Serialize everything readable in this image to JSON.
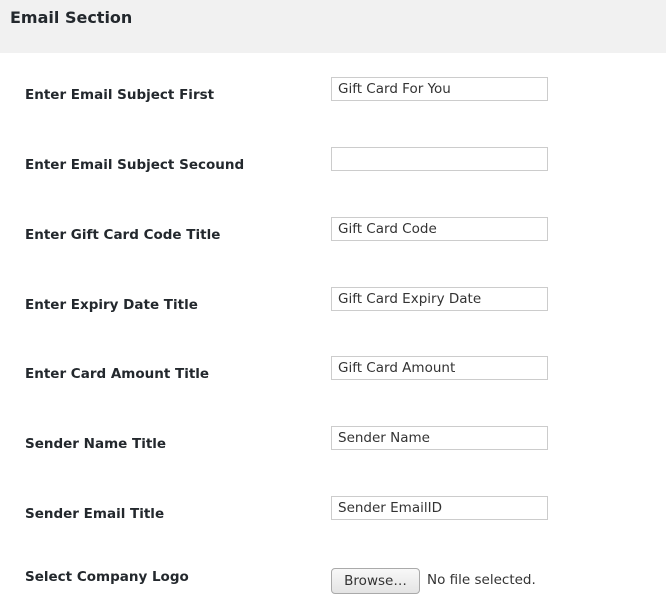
{
  "section": {
    "title": "Email Section"
  },
  "fields": [
    {
      "label": "Enter Email Subject First",
      "value": "Gift Card For You"
    },
    {
      "label": "Enter Email Subject Secound",
      "value": ""
    },
    {
      "label": "Enter Gift Card Code Title",
      "value": "Gift Card Code"
    },
    {
      "label": "Enter Expiry Date Title",
      "value": "Gift Card Expiry Date"
    },
    {
      "label": "Enter Card Amount Title",
      "value": "Gift Card Amount"
    },
    {
      "label": "Sender Name Title",
      "value": "Sender Name"
    },
    {
      "label": "Sender Email Title",
      "value": "Sender EmailID"
    }
  ],
  "logo": {
    "label": "Select Company Logo",
    "button_label": "Browse…",
    "status": "No file selected."
  }
}
